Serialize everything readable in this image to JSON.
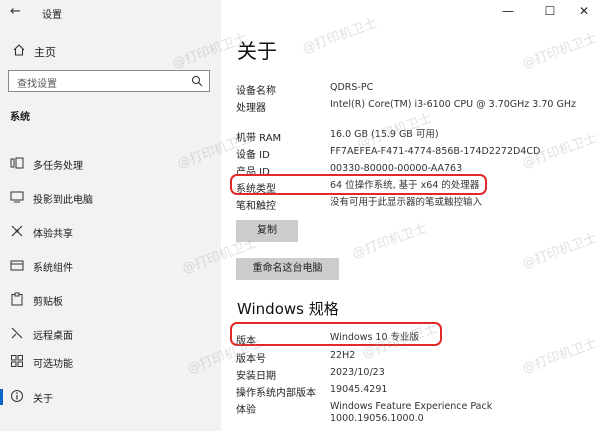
{
  "app": {
    "title": "设置",
    "back_icon": "back-arrow-icon"
  },
  "window": {
    "minimize": "—",
    "maximize": "☐",
    "close": "✕"
  },
  "sidebar": {
    "home_label": "主页",
    "search_placeholder": "查找设置",
    "section_label": "系统",
    "items": [
      {
        "label": "多任务处理",
        "icon": "multitask-icon"
      },
      {
        "label": "投影到此电脑",
        "icon": "project-icon"
      },
      {
        "label": "体验共享",
        "icon": "share-icon"
      },
      {
        "label": "系统组件",
        "icon": "components-icon"
      },
      {
        "label": "剪贴板",
        "icon": "clipboard-icon"
      },
      {
        "label": "远程桌面",
        "icon": "remote-icon"
      },
      {
        "label": "可选功能",
        "icon": "optional-icon"
      },
      {
        "label": "关于",
        "icon": "info-icon",
        "active": true
      }
    ]
  },
  "main": {
    "title": "关于",
    "device_specs": [
      {
        "key": "设备名称",
        "value": "QDRS-PC"
      },
      {
        "key": "处理器",
        "value": "Intel(R) Core(TM) i3-6100 CPU @ 3.70GHz 3.70 GHz"
      },
      {
        "key": "机带 RAM",
        "value": "16.0 GB (15.9 GB 可用)"
      },
      {
        "key": "设备 ID",
        "value": "FF7AEFEA-F471-4774-856B-174D2272D4CD"
      },
      {
        "key": "产品 ID",
        "value": "00330-80000-00000-AA763"
      },
      {
        "key": "系统类型",
        "value": "64 位操作系统, 基于 x64 的处理器"
      },
      {
        "key": "笔和触控",
        "value": "没有可用于此显示器的笔或触控输入"
      }
    ],
    "copy_button": "复制",
    "rename_button": "重命名这台电脑",
    "windows_title": "Windows 规格",
    "windows_specs": [
      {
        "key": "版本",
        "value": "Windows 10 专业版"
      },
      {
        "key": "版本号",
        "value": "22H2"
      },
      {
        "key": "安装日期",
        "value": "2023/10/23"
      },
      {
        "key": "操作系统内部版本",
        "value": "19045.4291"
      },
      {
        "key": "体验",
        "value": "Windows Feature Experience Pack 1000.19056.1000.0"
      }
    ]
  },
  "watermark": "@打印机卫士",
  "colors": {
    "sidebar_bg": "#f2f2f2",
    "accent": "#0a67c7",
    "highlight": "#e02a2a",
    "button_bg": "#cccccc"
  }
}
